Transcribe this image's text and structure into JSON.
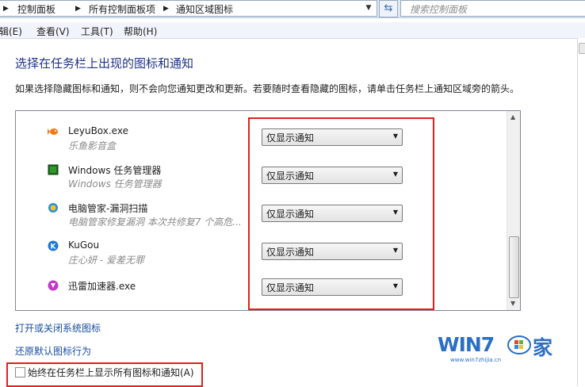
{
  "address_bar": {
    "crumbs": [
      "控制面板",
      "所有控制面板项",
      "通知区域图标"
    ],
    "search_placeholder": "搜索控制面板"
  },
  "menu": {
    "items": [
      "辑(E)",
      "查看(V)",
      "工具(T)",
      "帮助(H)"
    ]
  },
  "page": {
    "title": "选择在任务栏上出现的图标和通知",
    "description": "如果选择隐藏图标和通知，则不会向您通知更改和更新。若要随时查看隐藏的图标，请单击任务栏上通知区域旁的箭头。"
  },
  "list": {
    "items": [
      {
        "name": "LeyuBox.exe",
        "subtitle": "乐鱼影音盒",
        "behavior": "仅显示通知",
        "icon": "leyubox-fish-icon"
      },
      {
        "name": "Windows 任务管理器",
        "subtitle": "Windows 任务管理器",
        "behavior": "仅显示通知",
        "icon": "task-manager-icon"
      },
      {
        "name": "电脑管家-漏洞扫描",
        "subtitle": "电脑管家修复漏洞 本次共修复7 个高危...",
        "behavior": "仅显示通知",
        "icon": "pc-manager-icon"
      },
      {
        "name": "KuGou",
        "subtitle": "庄心妍 - 爱差无罪",
        "behavior": "仅显示通知",
        "icon": "kugou-icon"
      },
      {
        "name": "迅雷加速器.exe",
        "subtitle": "",
        "behavior": "仅显示通知",
        "icon": "xunlei-icon"
      }
    ]
  },
  "links": {
    "system_icons": "打开或关闭系统图标",
    "restore_default": "还原默认图标行为"
  },
  "always_show": {
    "label": "始终在任务栏上显示所有图标和通知(A)",
    "checked": false
  },
  "watermark": {
    "brand": "WIN7",
    "char": "家",
    "url": "www.win7zhijia.cn"
  },
  "colors": {
    "highlight_border": "#e11e1e",
    "link": "#1a4ea0",
    "title": "#1e3287"
  }
}
